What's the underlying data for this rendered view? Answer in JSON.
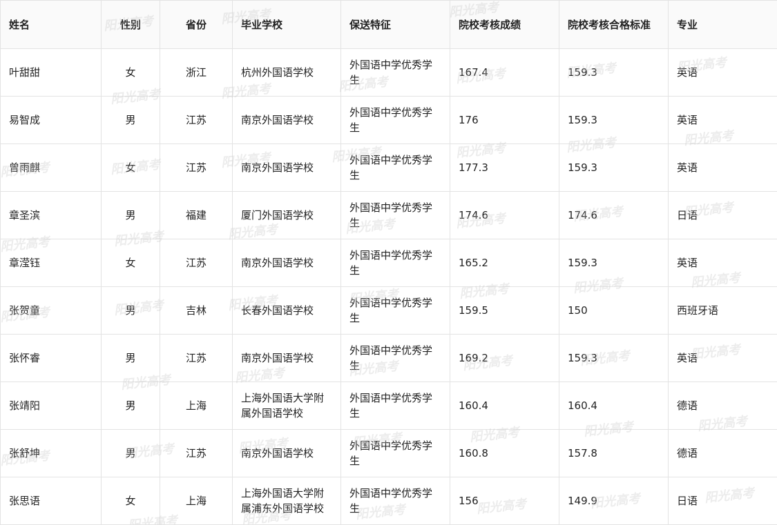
{
  "table": {
    "headers": [
      "姓名",
      "性别",
      "省份",
      "毕业学校",
      "保送特征",
      "院校考核成绩",
      "院校考核合格标准",
      "专业"
    ],
    "rows": [
      [
        "叶甜甜",
        "女",
        "浙江",
        "杭州外国语学校",
        "外国语中学优秀学生",
        "167.4",
        "159.3",
        "英语"
      ],
      [
        "易智成",
        "男",
        "江苏",
        "南京外国语学校",
        "外国语中学优秀学生",
        "176",
        "159.3",
        "英语"
      ],
      [
        "曾雨麒",
        "女",
        "江苏",
        "南京外国语学校",
        "外国语中学优秀学生",
        "177.3",
        "159.3",
        "英语"
      ],
      [
        "章圣滨",
        "男",
        "福建",
        "厦门外国语学校",
        "外国语中学优秀学生",
        "174.6",
        "174.6",
        "日语"
      ],
      [
        "章滢钰",
        "女",
        "江苏",
        "南京外国语学校",
        "外国语中学优秀学生",
        "165.2",
        "159.3",
        "英语"
      ],
      [
        "张贺童",
        "男",
        "吉林",
        "长春外国语学校",
        "外国语中学优秀学生",
        "159.5",
        "150",
        "西班牙语"
      ],
      [
        "张怀睿",
        "男",
        "江苏",
        "南京外国语学校",
        "外国语中学优秀学生",
        "169.2",
        "159.3",
        "英语"
      ],
      [
        "张靖阳",
        "男",
        "上海",
        "上海外国语大学附属外国语学校",
        "外国语中学优秀学生",
        "160.4",
        "160.4",
        "德语"
      ],
      [
        "张舒坤",
        "男",
        "江苏",
        "南京外国语学校",
        "外国语中学优秀学生",
        "160.8",
        "157.8",
        "德语"
      ],
      [
        "张思语",
        "女",
        "上海",
        "上海外国语大学附属浦东外国语学校",
        "外国语中学优秀学生",
        "156",
        "149.9",
        "日语"
      ]
    ]
  },
  "watermark": {
    "text": "阳光高考"
  }
}
